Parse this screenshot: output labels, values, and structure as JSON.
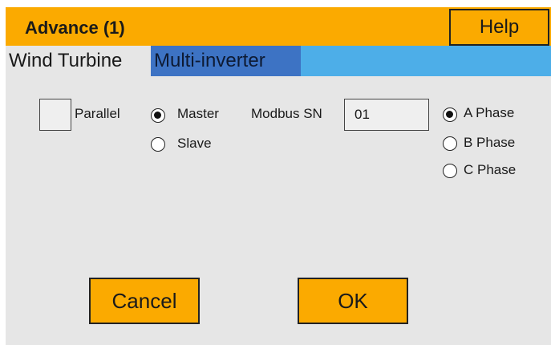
{
  "header": {
    "title": "Advance (1)",
    "help_label": "Help"
  },
  "tabs": [
    {
      "label": "Wind Turbine",
      "active": false
    },
    {
      "label": "Multi-inverter",
      "active": true
    }
  ],
  "form": {
    "parallel_label": "Parallel",
    "parallel_checked": false,
    "role_options": [
      {
        "label": "Master",
        "checked": true
      },
      {
        "label": "Slave",
        "checked": false
      }
    ],
    "modbus_sn_label": "Modbus SN",
    "modbus_sn_value": "01",
    "phase_options": [
      {
        "label": "A Phase",
        "checked": true
      },
      {
        "label": "B Phase",
        "checked": false
      },
      {
        "label": "C Phase",
        "checked": false
      }
    ]
  },
  "footer": {
    "cancel_label": "Cancel",
    "ok_label": "OK"
  },
  "colors": {
    "accent_orange": "#fbaa00",
    "tab_bar_blue": "#4daee8",
    "active_tab_blue": "#3d73c4",
    "panel_gray": "#e6e6e6"
  }
}
